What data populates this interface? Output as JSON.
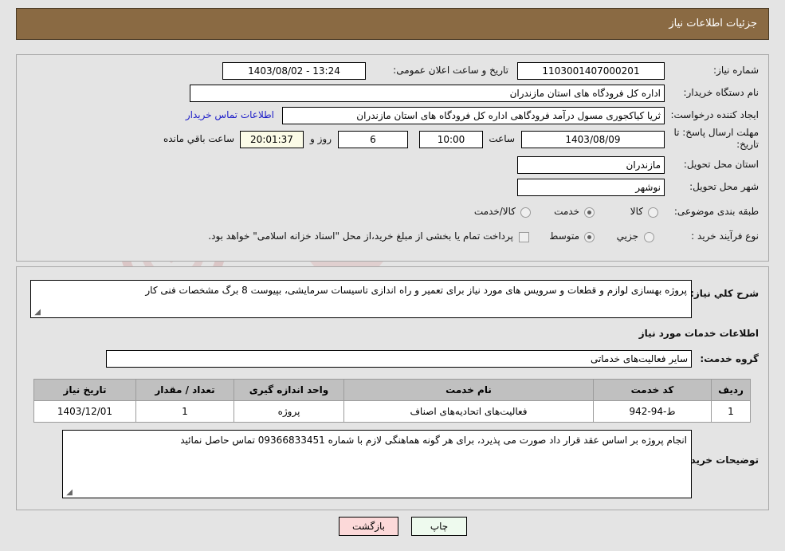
{
  "header": {
    "title": "جزئیات اطلاعات نیاز",
    "bar_color": "#8a6a43"
  },
  "watermark": {
    "text": "AriaTender.net"
  },
  "form": {
    "need_number_label": "شماره نیاز:",
    "need_number_value": "1103001407000201",
    "public_announce_label": "تاریخ و ساعت اعلان عمومی:",
    "public_announce_value": "13:24 - 1403/08/02",
    "buyer_org_label": "نام دستگاه خریدار:",
    "buyer_org_value": "اداره کل فرودگاه های استان مازندران",
    "creator_label": "ایجاد کننده درخواست:",
    "creator_value": "ثریا کیاکجوری مسول درآمد فرودگاهی اداره کل فرودگاه های استان مازندران",
    "contact_link": "اطلاعات تماس خریدار",
    "deadline_label": "مهلت ارسال پاسخ: تا تاریخ:",
    "deadline_date": "1403/08/09",
    "hour_label": "ساعت",
    "deadline_time": "10:00",
    "days_remaining": "6",
    "days_word": "روز و",
    "time_remaining": "20:01:37",
    "remaining_suffix": "ساعت باقي مانده",
    "province_label": "استان محل تحویل:",
    "province_value": "مازندران",
    "city_label": "شهر محل تحویل:",
    "city_value": "نوشهر",
    "category_label": "طبقه بندی موضوعی:",
    "category_options": [
      {
        "label": "کالا",
        "selected": false
      },
      {
        "label": "خدمت",
        "selected": true
      },
      {
        "label": "کالا/خدمت",
        "selected": false
      }
    ],
    "process_label": "نوع فرآیند خرید :",
    "process_options": [
      {
        "label": "جزیي",
        "selected": false
      },
      {
        "label": "متوسط",
        "selected": true
      }
    ],
    "treasury_checkbox_label": "پرداخت تمام یا بخشی از مبلغ خرید،از محل \"اسناد خزانه اسلامی\" خواهد بود.",
    "treasury_checked": false
  },
  "description": {
    "label": "شرح کلي نیاز:",
    "value": "پروژه بهسازی لوازم و قطعات و سرویس های مورد نیاز برای تعمیر و راه اندازی تاسیسات سرمایشی، بپیوست 8 برگ مشخصات فنی کار"
  },
  "services_section": {
    "title": "اطلاعات خدمات مورد نیاز",
    "group_label": "گروه خدمت:",
    "group_value": "سایر فعالیت‌های خدماتی",
    "table": {
      "columns": [
        "ردیف",
        "کد خدمت",
        "نام خدمت",
        "واحد اندازه گیری",
        "تعداد / مقدار",
        "تاریخ نیاز"
      ],
      "rows": [
        [
          "1",
          "ط-94-942",
          "فعالیت‌های اتحادیه‌های اصناف",
          "پروژه",
          "1",
          "1403/12/01"
        ]
      ]
    }
  },
  "buyer_notes": {
    "label": "توضیحات خریدار:",
    "value": "انجام پروژه بر اساس عقد قرار داد صورت می پذیرد، برای هر گونه هماهنگی لازم با شماره 09366833451 تماس حاصل نمائید"
  },
  "footer": {
    "print_label": "چاپ",
    "back_label": "بازگشت"
  }
}
